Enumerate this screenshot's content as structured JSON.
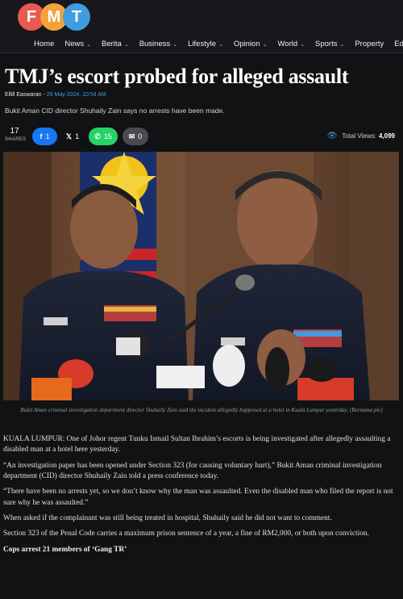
{
  "brand": {
    "letters": [
      "F",
      "M",
      "T"
    ]
  },
  "nav": {
    "items": [
      {
        "label": "Home",
        "has_dropdown": false
      },
      {
        "label": "News",
        "has_dropdown": true
      },
      {
        "label": "Berita",
        "has_dropdown": true
      },
      {
        "label": "Business",
        "has_dropdown": true
      },
      {
        "label": "Lifestyle",
        "has_dropdown": true
      },
      {
        "label": "Opinion",
        "has_dropdown": true
      },
      {
        "label": "World",
        "has_dropdown": true
      },
      {
        "label": "Sports",
        "has_dropdown": true
      },
      {
        "label": "Property",
        "has_dropdown": false
      },
      {
        "label": "Educ",
        "has_dropdown": false
      }
    ]
  },
  "article": {
    "headline": "TMJ’s escort probed for alleged assault",
    "author": "Ellill Easwaran",
    "separator": " - ",
    "date": "29 May 2024, 10:54 AM",
    "subhead": "Bukit Aman CID director Shuhaily Zain says no arrests have been made.",
    "caption": "Bukit Aman criminal investigation department director Shuhaily Zain said the incident allegedly happened at a hotel in Kuala Lumpur yesterday. (Bernama pic)",
    "paragraphs": [
      "KUALA LUMPUR: One of Johor regent Tunku Ismail Sultan Ibrahim’s escorts is being investigated after allegedly assaulting a disabled man at a hotel here yesterday.",
      "“An investigation paper has been opened under Section 323 (for causing voluntary hurt),” Bukit Aman criminal investigation department (CID) director Shuhaily Zain told a press conference today.",
      "“There have been no arrests yet, so we don’t know why the man was assaulted. Even the disabled man who filed the report is not sure why he was assaulted.”",
      "When asked if the complainant was still being treated in hospital, Shuhaily said he did not want to comment.",
      "Section 323 of the Penal Code carries a maximum prison sentence of a year, a fine of RM2,000, or both upon conviction."
    ],
    "related_link": "Cops arrest 21 members of ‘Gang TR’"
  },
  "share": {
    "count": "17",
    "label": "SHARES",
    "facebook": {
      "icon": "facebook-icon",
      "count": "1"
    },
    "x": {
      "icon": "x-icon",
      "count": "1"
    },
    "whatsapp": {
      "icon": "whatsapp-icon",
      "count": "15"
    },
    "email": {
      "icon": "mail-icon",
      "count": "0"
    },
    "views_label": "Total Views:",
    "views_count": "4,099"
  },
  "colors": {
    "background": "#111214",
    "accent": "#3f9ce0",
    "facebook": "#1877f2",
    "whatsapp": "#25d366"
  }
}
